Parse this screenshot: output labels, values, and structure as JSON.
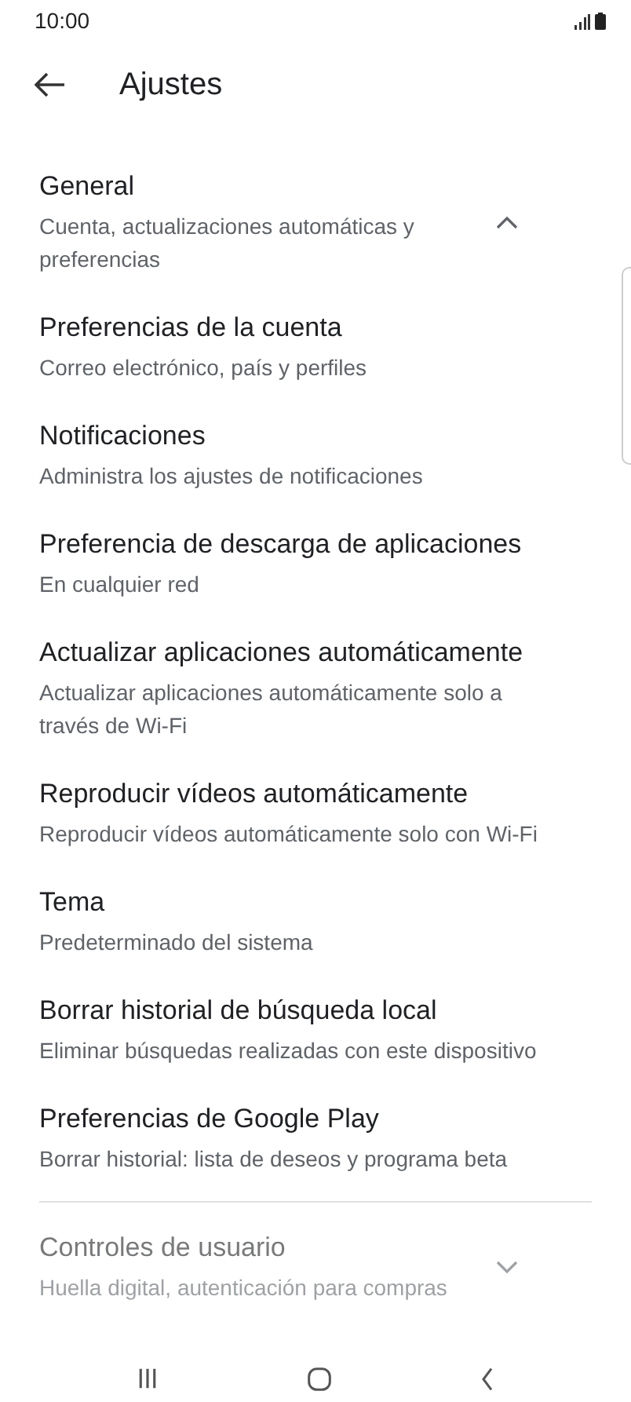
{
  "status_bar": {
    "time": "10:00"
  },
  "header": {
    "title": "Ajustes"
  },
  "sections": [
    {
      "title": "General",
      "subtitle": "Cuenta, actualizaciones automáticas y preferencias",
      "expanded": true,
      "items": [
        {
          "title": "Preferencias de la cuenta",
          "subtitle": "Correo electrónico, país y perfiles"
        },
        {
          "title": "Notificaciones",
          "subtitle": "Administra los ajustes de notificaciones"
        },
        {
          "title": "Preferencia de descarga de aplicaciones",
          "subtitle": "En cualquier red"
        },
        {
          "title": "Actualizar aplicaciones automáticamente",
          "subtitle": "Actualizar aplicaciones automáticamente solo a través de Wi-Fi"
        },
        {
          "title": "Reproducir vídeos automáticamente",
          "subtitle": "Reproducir vídeos automáticamente solo con Wi-Fi"
        },
        {
          "title": "Tema",
          "subtitle": "Predeterminado del sistema"
        },
        {
          "title": "Borrar historial de búsqueda local",
          "subtitle": "Eliminar búsquedas realizadas con este dispositivo"
        },
        {
          "title": "Preferencias de Google Play",
          "subtitle": "Borrar historial: lista de deseos y programa beta"
        }
      ]
    },
    {
      "title": "Controles de usuario",
      "subtitle": "Huella digital, autenticación para compras",
      "expanded": false
    }
  ]
}
